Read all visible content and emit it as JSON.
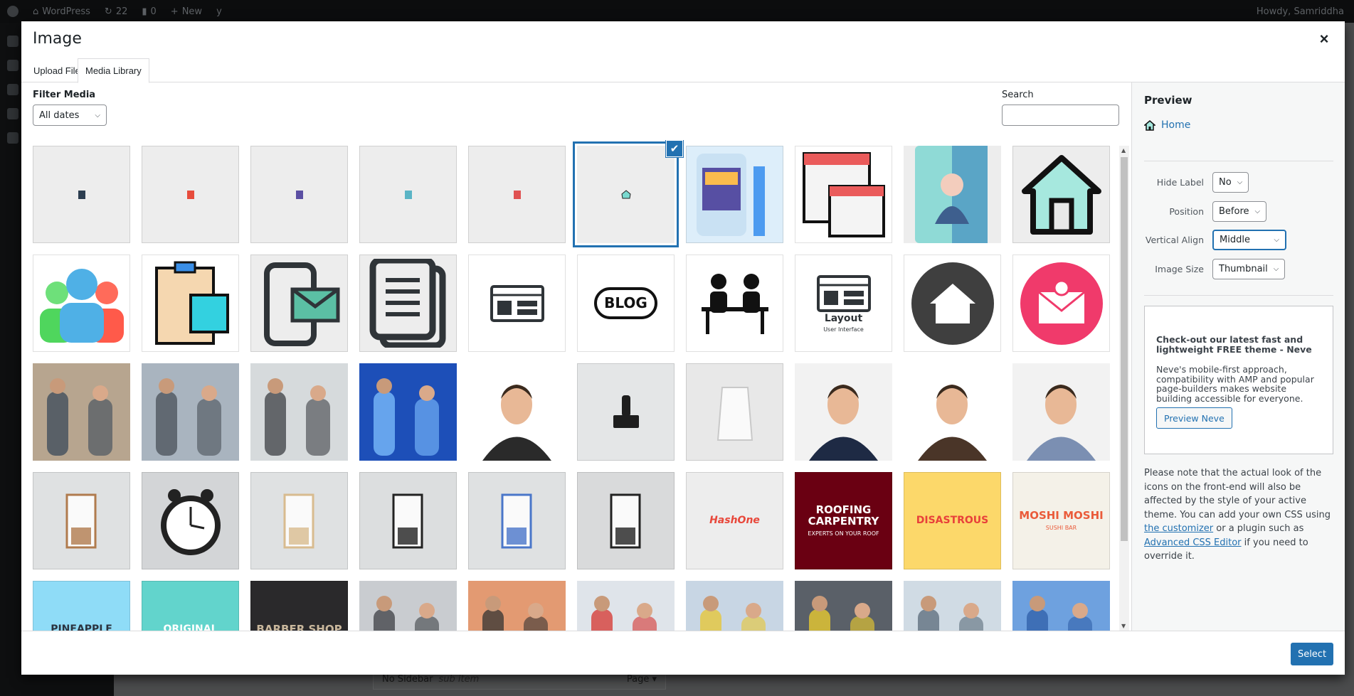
{
  "adminbar": {
    "site": "WordPress",
    "updates": "22",
    "comments": "0",
    "new": "New",
    "howdy": "Howdy, Samriddha"
  },
  "behind": {
    "item": "No Sidebar",
    "sub": "sub item",
    "type": "Page ▾"
  },
  "modal": {
    "title": "Image",
    "close": "×",
    "tabs": [
      {
        "label": "Upload Files",
        "active": false
      },
      {
        "label": "Media Library",
        "active": true
      }
    ],
    "filter_label": "Filter Media",
    "date_filter": "All dates",
    "search_label": "Search",
    "search_value": ""
  },
  "tiles": [
    {
      "bg": "#ededed",
      "fg": "#2c3e50",
      "art": "tiny"
    },
    {
      "bg": "#ededed",
      "fg": "#e74c3c",
      "art": "tiny"
    },
    {
      "bg": "#ededed",
      "fg": "#5b4fa3",
      "art": "tiny"
    },
    {
      "bg": "#ededed",
      "fg": "#5ab4c5",
      "art": "tiny"
    },
    {
      "bg": "#ededed",
      "fg": "#e05252",
      "art": "tiny"
    },
    {
      "bg": "#ededed",
      "fg": "#7ad9cf",
      "art": "tiny-house",
      "selected": true
    },
    {
      "bg": "#ddeefa",
      "fg": "#574fa3",
      "art": "tablet"
    },
    {
      "bg": "#ffffff",
      "fg": "#ea5b5b",
      "art": "windows"
    },
    {
      "bg": "#8fdad6",
      "fg": "#3e5f8e",
      "art": "contact"
    },
    {
      "bg": "#ededed",
      "fg": "#a6e8de",
      "art": "house"
    },
    {
      "bg": "#ffffff",
      "fg": "#4fb0e6",
      "art": "people"
    },
    {
      "bg": "#ffffff",
      "fg": "#33d1e0",
      "art": "clipboard"
    },
    {
      "bg": "#ededed",
      "fg": "#5bbfa4",
      "art": "phone-mail"
    },
    {
      "bg": "#ededed",
      "fg": "#2f3438",
      "art": "documents"
    },
    {
      "bg": "#ffffff",
      "fg": "#2f3438",
      "art": "layout"
    },
    {
      "bg": "#ffffff",
      "fg": "#111111",
      "art": "bubble",
      "label": "BLOG"
    },
    {
      "bg": "#ffffff",
      "fg": "#111111",
      "art": "desk"
    },
    {
      "bg": "#ffffff",
      "fg": "#2f3438",
      "art": "layout",
      "label": "Layout",
      "sublabel": "User Interface"
    },
    {
      "bg": "#ffffff",
      "fg": "#3f3f3f",
      "art": "circle-house"
    },
    {
      "bg": "#ffffff",
      "fg": "#f03a6b",
      "art": "circle-mail"
    },
    {
      "bg": "#b7a58f",
      "fg": "#3a4a5a",
      "art": "photo"
    },
    {
      "bg": "#a9b4bf",
      "fg": "#4a5058",
      "art": "photo"
    },
    {
      "bg": "#d6dadc",
      "fg": "#3c3f44",
      "art": "photo"
    },
    {
      "bg": "#1d4fb8",
      "fg": "#7fc0ff",
      "art": "photo"
    },
    {
      "bg": "#ffffff",
      "fg": "#2a2a2a",
      "art": "portrait"
    },
    {
      "bg": "#e4e6e7",
      "fg": "#1e1e1e",
      "art": "stamp"
    },
    {
      "bg": "#e8e8e8",
      "fg": "#c9c9c9",
      "art": "bag"
    },
    {
      "bg": "#f2f2f2",
      "fg": "#1e2a44",
      "art": "portrait"
    },
    {
      "bg": "#ffffff",
      "fg": "#4a3528",
      "art": "portrait"
    },
    {
      "bg": "#f2f2f2",
      "fg": "#7b8fb2",
      "art": "portrait"
    },
    {
      "bg": "#dfe1e2",
      "fg": "#b07b4e",
      "art": "mockup"
    },
    {
      "bg": "#d3d5d7",
      "fg": "#222222",
      "art": "clock"
    },
    {
      "bg": "#dfe1e2",
      "fg": "#d8bb8f",
      "art": "mockup"
    },
    {
      "bg": "#dcdedf",
      "fg": "#222222",
      "art": "mockup"
    },
    {
      "bg": "#dfe1e2",
      "fg": "#4a76c9",
      "art": "mockup"
    },
    {
      "bg": "#d9dadb",
      "fg": "#222222",
      "art": "mockup"
    },
    {
      "bg": "#ededed",
      "fg": "#e8473a",
      "art": "logo",
      "label": "HashOne"
    },
    {
      "bg": "#6a0012",
      "fg": "#ffffff",
      "art": "logo",
      "label": "ROOFING CARPENTRY",
      "sublabel": "EXPERTS ON YOUR ROOF"
    },
    {
      "bg": "#fcd86a",
      "fg": "#e8403a",
      "art": "logo",
      "label": "DISASTROUS"
    },
    {
      "bg": "#f4f1e8",
      "fg": "#ea5b3a",
      "art": "logo",
      "label": "MOSHI MOSHI",
      "sublabel": "SUSHI BAR"
    },
    {
      "bg": "#8fdcf7",
      "fg": "#2b3440",
      "art": "logo",
      "label": "PINEAPPLE"
    },
    {
      "bg": "#62d4cc",
      "fg": "#ffffff",
      "art": "logo",
      "label": "ORIGINAL"
    },
    {
      "bg": "#2a292b",
      "fg": "#c9b79c",
      "art": "logo",
      "label": "BARBER SHOP"
    },
    {
      "bg": "#c9ccd0",
      "fg": "#3c3f44",
      "art": "photo"
    },
    {
      "bg": "#e39a72",
      "fg": "#333333",
      "art": "photo"
    },
    {
      "bg": "#dfe4ea",
      "fg": "#d6342e",
      "art": "photo"
    },
    {
      "bg": "#c8d6e4",
      "fg": "#e8c530",
      "art": "photo"
    },
    {
      "bg": "#5a6068",
      "fg": "#f1d02c",
      "art": "photo"
    },
    {
      "bg": "#d0dbe4",
      "fg": "#5a6a7a",
      "art": "photo"
    },
    {
      "bg": "#6ea1df",
      "fg": "#2f5fa8",
      "art": "photo"
    }
  ],
  "preview": {
    "title": "Preview",
    "item_label": "Home",
    "accent": "#2271b1",
    "fields": [
      {
        "label": "Hide Label",
        "value": "No"
      },
      {
        "label": "Position",
        "value": "Before"
      },
      {
        "label": "Vertical Align",
        "value": "Middle",
        "focused": true
      },
      {
        "label": "Image Size",
        "value": "Thumbnail"
      }
    ],
    "promo": {
      "heading": "Check-out our latest fast and lightweight FREE theme - Neve",
      "text": "Neve's mobile-first approach, compatibility with AMP and popular page-builders makes website building accessible for everyone.",
      "button": "Preview Neve"
    },
    "note": {
      "part1": "Please note that the actual look of the icons on the front-end will also be affected by the style of your active theme. You can add your own CSS using ",
      "link1": "the customizer",
      "part2": " or a plugin such as ",
      "link2": "Advanced CSS Editor",
      "part3": " if you need to override it."
    }
  },
  "footer": {
    "select": "Select"
  }
}
